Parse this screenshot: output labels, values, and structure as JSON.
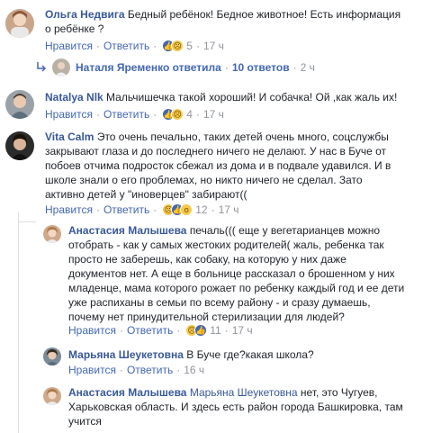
{
  "actions": {
    "like": "Нравится",
    "reply": "Ответить",
    "sep": "·"
  },
  "comments": [
    {
      "author": "Ольга Недвига",
      "text": "Бедный ребёнок! Бедное животное! Есть информация о ребёнке ?",
      "reaction_count": "5",
      "time": "17 ч"
    },
    {
      "author": "Natalya Nlk",
      "text": "Мальчишечка такой хороший! И собачка! Ой ,как жаль их!",
      "reaction_count": "4",
      "time": "17 ч"
    },
    {
      "author": "Vita Calm",
      "text": "Это очень печально, таких детей очень много, соцслужбы закрывают глаза и до последнего ничего не делают. У нас в Буче от побоев отчима подросток сбежал из дома и в подвале удавился. И в школе знали о его проблемах, но никто ничего не сделал. Зато активно детей у \"иноверцев\" забирают((",
      "reaction_count": "12",
      "time": "17 ч"
    }
  ],
  "reply_summary": {
    "text": "Наталя Яременко ответила",
    "count": "10 ответов",
    "time": "2 ч"
  },
  "replies": [
    {
      "author": "Анастасия Малышева",
      "text": "печаль((( еще у вегетарианцев можно отобрать - как у самых жестоких родителей( жаль, ребенка так просто не заберешь, как собаку, на которую у них даже документов нет. А еще в больнице рассказал о брошенном у них младенце, мама которого рожает по ребенку каждый год и ее дети уже распиханы в семьи по всему району - и сразу думаешь, почему нет принудительной стерилизации для людей?",
      "reaction_count": "11",
      "time": "17 ч"
    },
    {
      "author": "Марьяна Шеукетовна",
      "text": "В Буче где?какая школа?",
      "time": "16 ч"
    },
    {
      "author": "Анастасия Малышева",
      "mention": "Марьяна Шеукетовна",
      "text": " нет, это Чугуев, Харьковская область. И здесь есть район города Башкировка, там учится"
    }
  ],
  "icons": {
    "like": "thumbs-up-icon",
    "sad": "sad-face-icon",
    "wow": "wow-face-icon",
    "reply_arrow": "reply-arrow-icon"
  },
  "colors": {
    "link": "#385898",
    "meta": "#90949c",
    "like_blue": "#4267b2"
  }
}
